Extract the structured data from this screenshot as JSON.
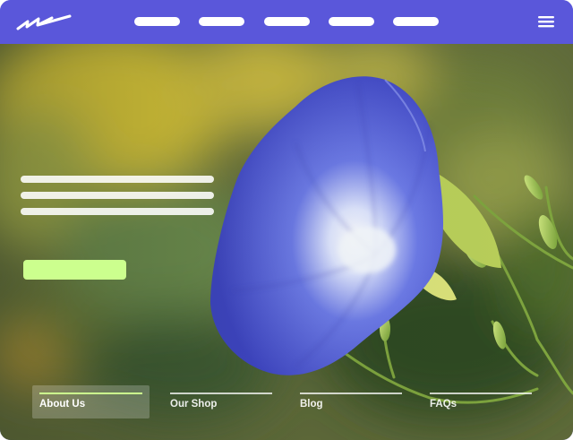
{
  "colors": {
    "navbar": "#5a57da",
    "accent_button": "#ccff8e",
    "active_tab_rule": "#ccff8e",
    "flower": "#4c59d6"
  },
  "header": {
    "logo_icon": "wave-logo-icon",
    "menu_icon": "hamburger-menu-icon"
  },
  "hero": {
    "image_icon": "morning-glory-photo"
  },
  "tabs": [
    {
      "label": "About Us",
      "active": true
    },
    {
      "label": "Our Shop",
      "active": false
    },
    {
      "label": "Blog",
      "active": false
    },
    {
      "label": "FAQs",
      "active": false
    }
  ]
}
